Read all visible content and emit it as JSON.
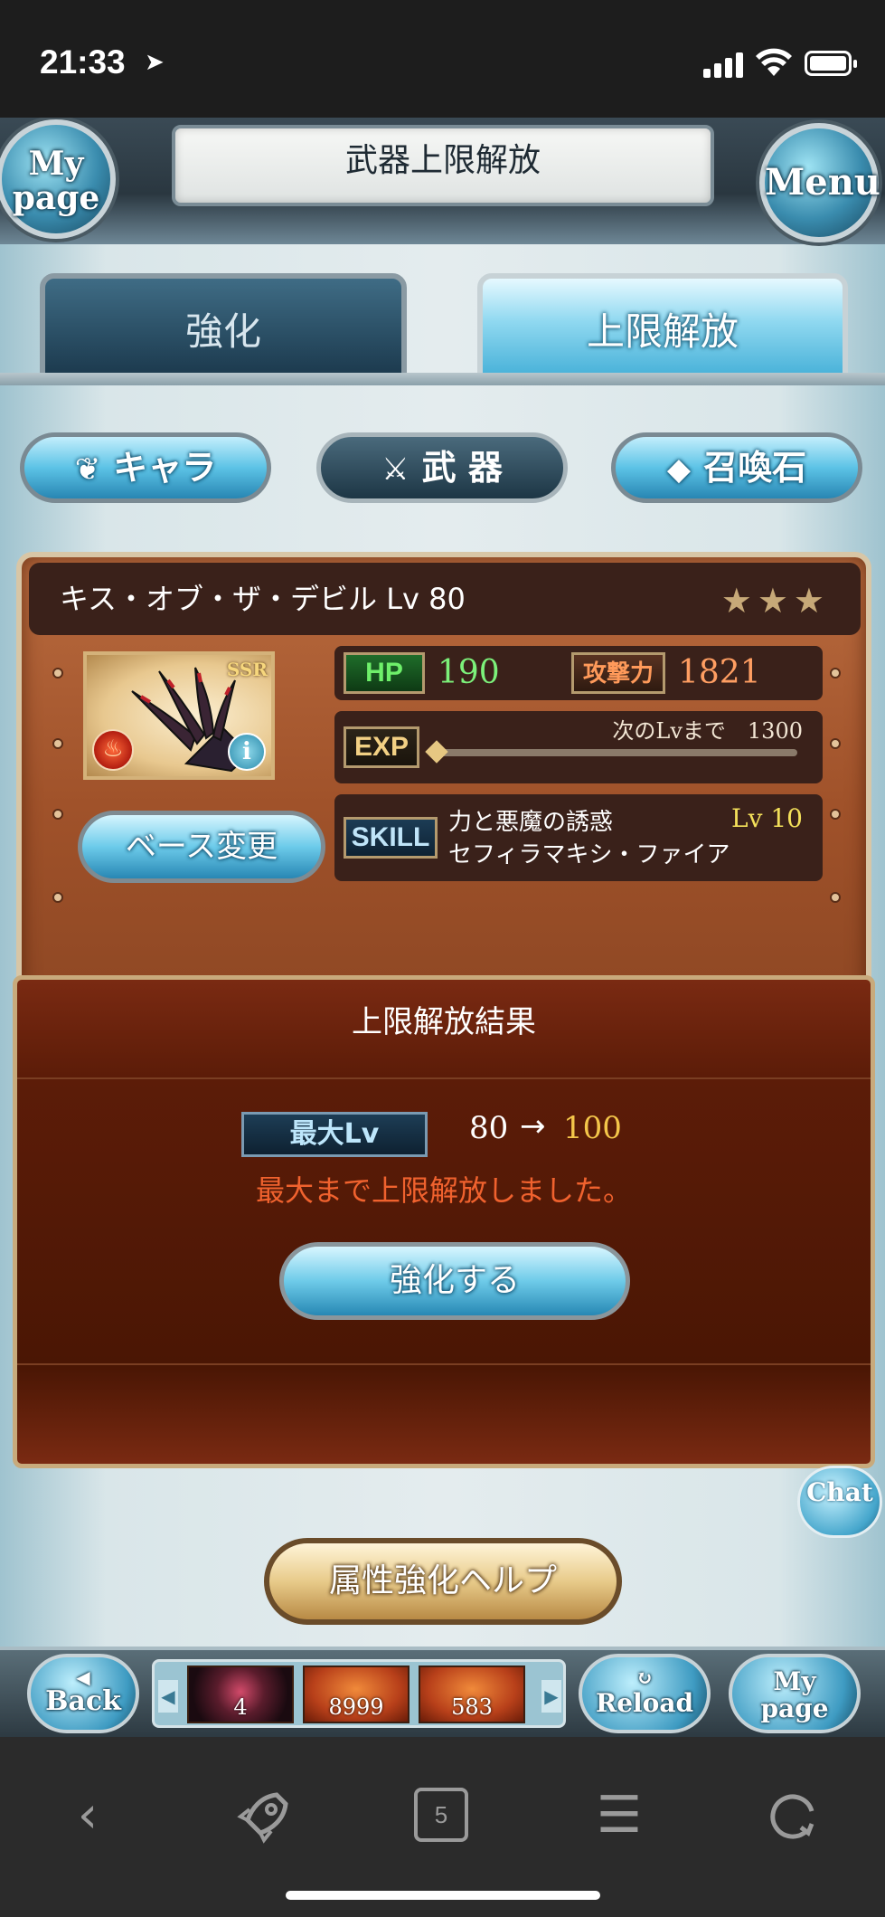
{
  "status_bar": {
    "time": "21:33"
  },
  "header": {
    "title": "武器上限解放",
    "my_page_line1": "My",
    "my_page_line2": "page",
    "menu_label": "Menu"
  },
  "tabs": [
    {
      "label": "強化",
      "active": false
    },
    {
      "label": "上限解放",
      "active": true
    }
  ],
  "categories": [
    {
      "label": "キャラ",
      "icon": "angel-icon",
      "active": false
    },
    {
      "label": "武 器",
      "icon": "crossed-swords-icon",
      "active": true
    },
    {
      "label": "召喚石",
      "icon": "crystal-icon",
      "active": false
    }
  ],
  "weapon": {
    "name": "キス・オブ・ザ・デビル Lv 80",
    "stars": "★★★",
    "rarity": "SSR",
    "element": "fire",
    "base_change_label": "ベース変更",
    "hp_label": "HP",
    "hp": "190",
    "atk_label": "攻撃力",
    "atk": "1821",
    "exp_label": "EXP",
    "exp_next_text": "次のLvまで　1300",
    "exp_progress": 0,
    "skill_label": "SKILL",
    "skill_name": "力と悪魔の誘惑",
    "skill_sub": "セフィラマキシ・ファイア",
    "skill_lv": "Lv 10"
  },
  "result": {
    "title": "上限解放結果",
    "max_lv_label": "最大Lv",
    "from": "80",
    "arrow": "→",
    "to": "100",
    "message": "最大まで上限解放しました。",
    "strengthen_label": "強化する"
  },
  "chat_label": "Chat",
  "element_help_label": "属性強化ヘルプ",
  "bottom_bar": {
    "back_line1": "◀",
    "back_line2": "Back",
    "reload_line1": "↻",
    "reload_line2": "Reload",
    "mypage_line1": "My",
    "mypage_line2": "page",
    "items": [
      {
        "value": "4",
        "icon": "dark-orb-icon"
      },
      {
        "value": "8999",
        "icon": "fire-fragment-icon"
      },
      {
        "value": "583",
        "icon": "fire-quartz-icon"
      }
    ]
  },
  "browser_toolbar": {
    "tab_count": "5"
  },
  "colors": {
    "hp_green": "#7cf07a",
    "atk_orange": "#ff9e62",
    "max_lv_gold": "#f4c64a",
    "message_red": "#f0622e",
    "skill_lv_yellow": "#f3e05a"
  }
}
